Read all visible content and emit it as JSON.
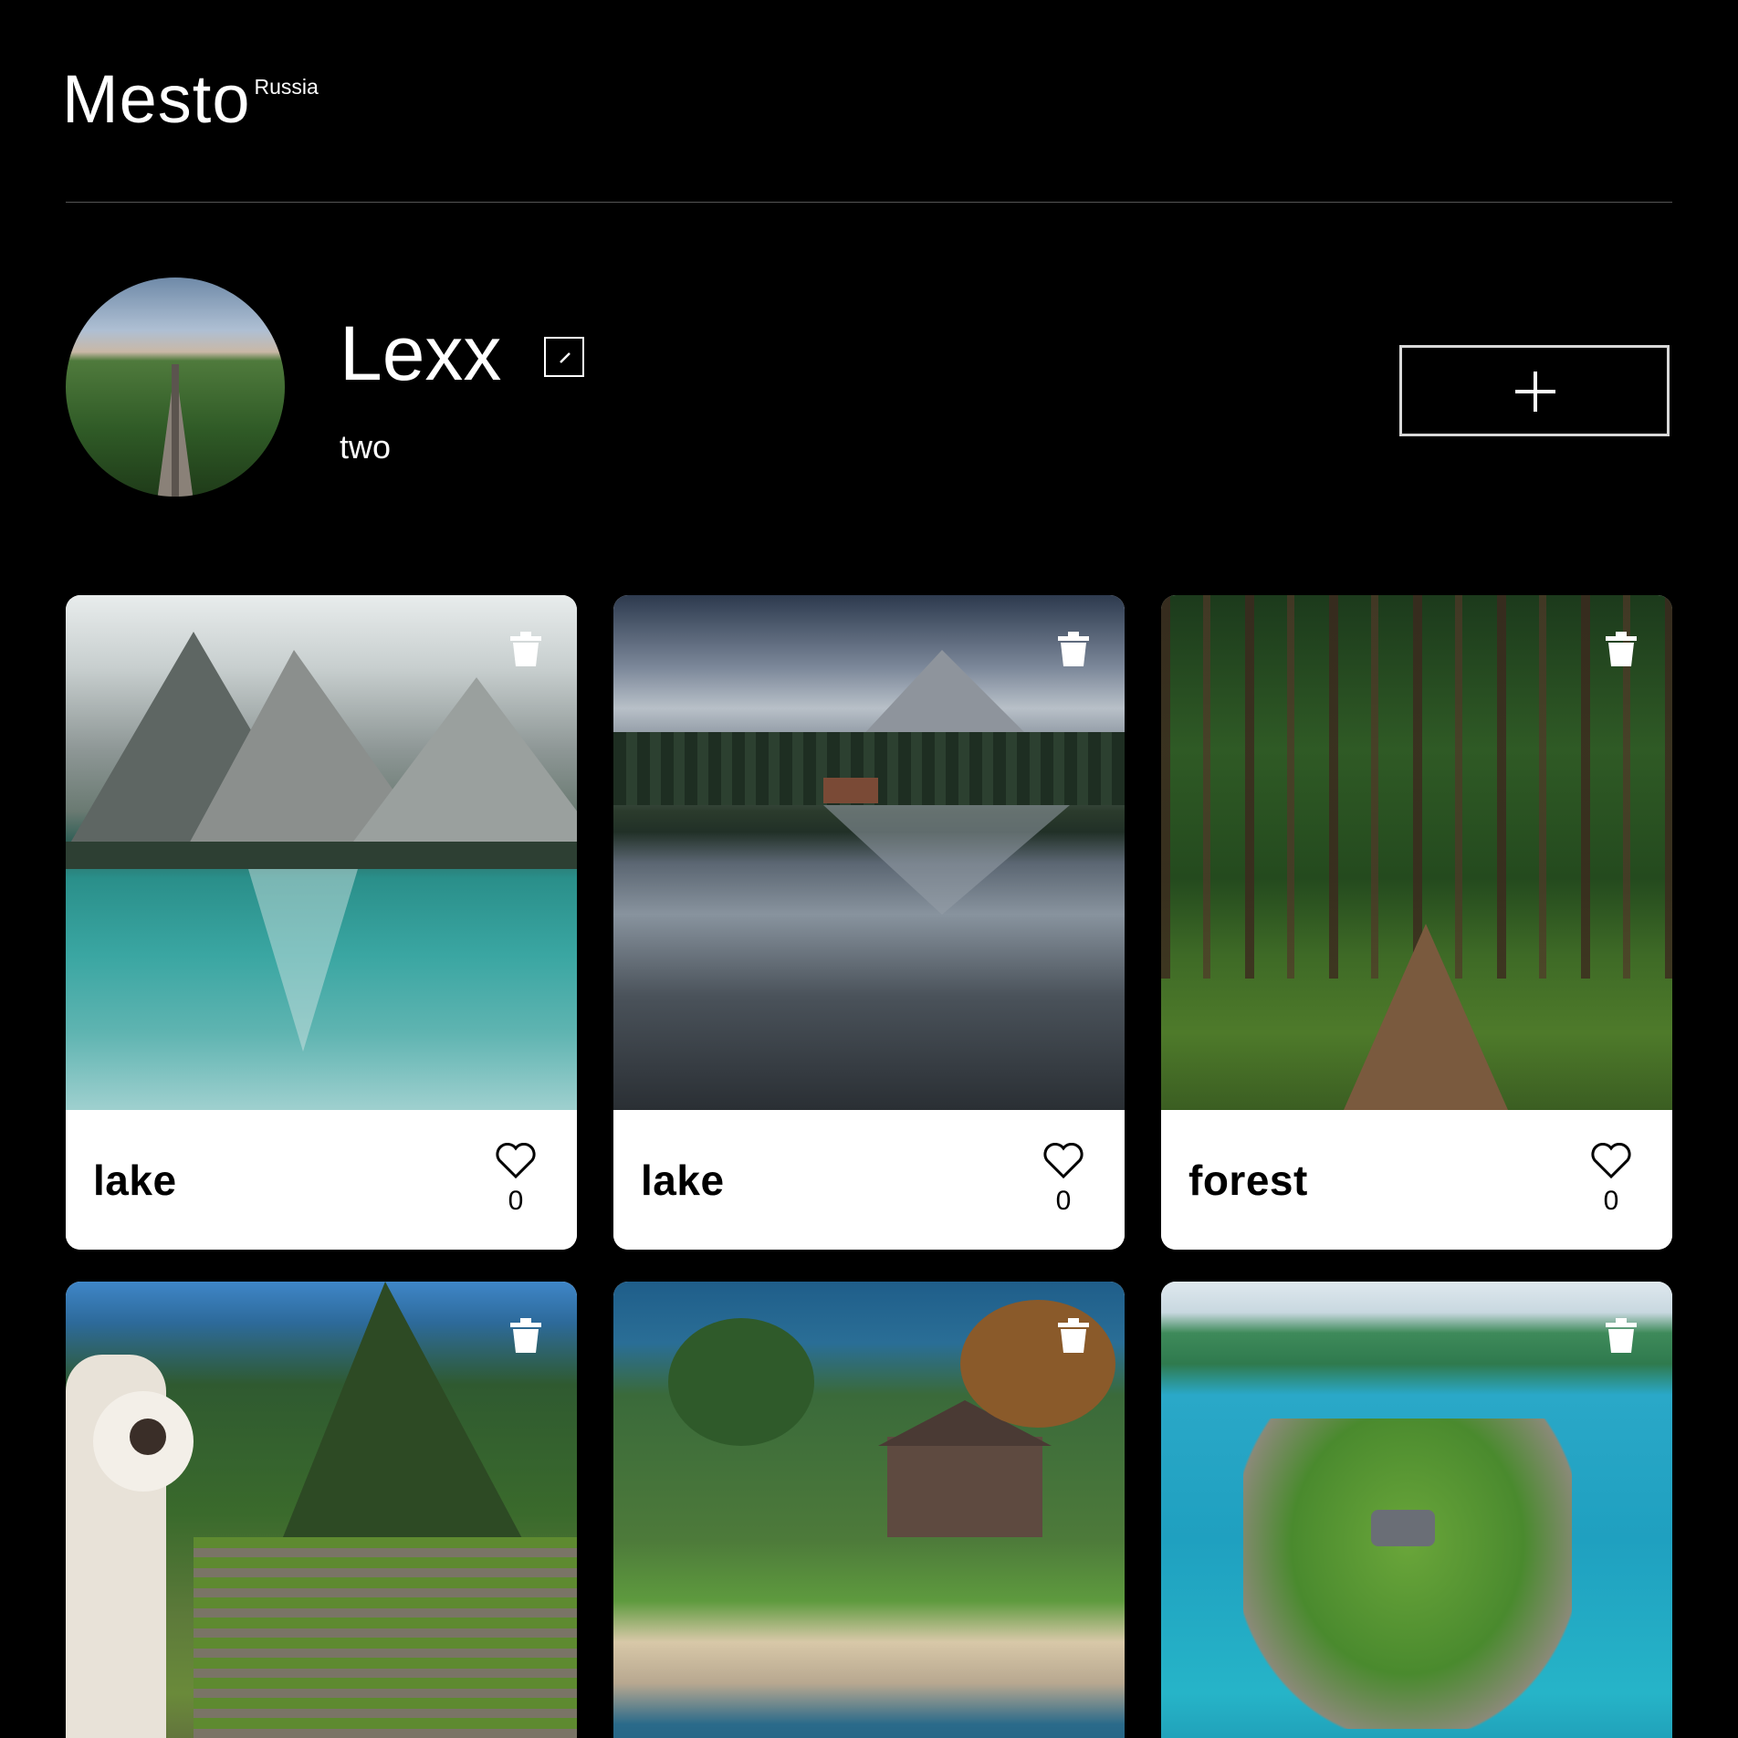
{
  "header": {
    "logo": "Mesto",
    "logo_sup": "Russia"
  },
  "profile": {
    "name": "Lexx",
    "job": "two"
  },
  "icons": {
    "edit": "pencil-icon",
    "add": "plus-icon",
    "delete": "trash-icon",
    "like": "heart-icon"
  },
  "cards": [
    {
      "title": "lake",
      "likes": "0",
      "scene": "glacier lake with turquoise water and misty mountains"
    },
    {
      "title": "lake",
      "likes": "0",
      "scene": "mountain lake with lodge and forest reflection"
    },
    {
      "title": "forest",
      "likes": "0",
      "scene": "green pine forest path"
    },
    {
      "title": "",
      "likes": "",
      "scene": "llama and Machu Picchu mountains"
    },
    {
      "title": "",
      "likes": "",
      "scene": "coastal mansion on rocky shore"
    },
    {
      "title": "",
      "likes": "",
      "scene": "aerial tropical island with turquoise sea"
    }
  ]
}
